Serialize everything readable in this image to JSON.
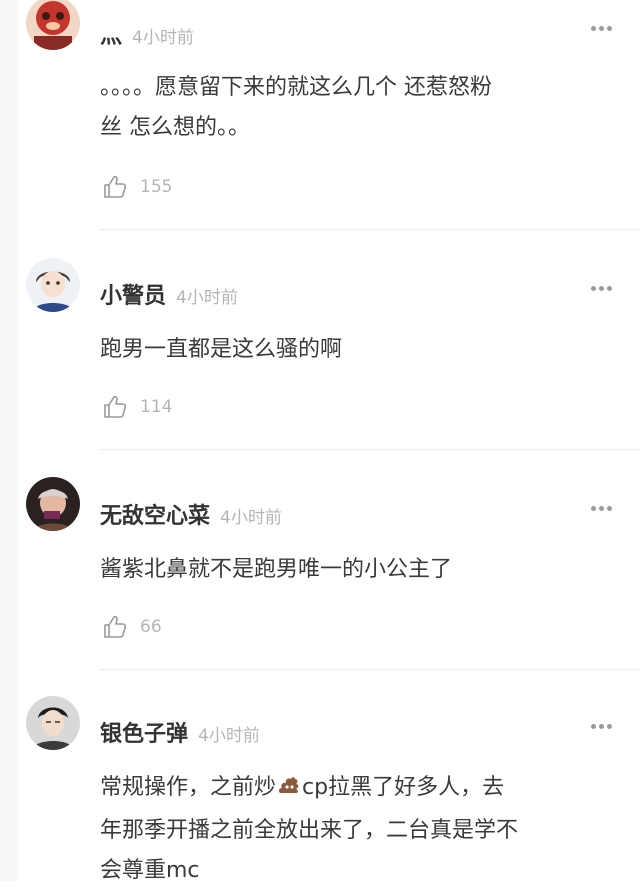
{
  "comments": [
    {
      "username": "灬",
      "time": "4小时前",
      "text_lines": [
        "。。。。愿意留下来的就这么几个 还惹怒粉",
        "丝 怎么想的。。"
      ],
      "likes": "155",
      "avatar_color": "#c4352d"
    },
    {
      "username": "小警员",
      "time": "4小时前",
      "text_lines": [
        "跑男一直都是这么骚的啊"
      ],
      "likes": "114",
      "avatar_color": "#2f4a8a"
    },
    {
      "username": "无敌空心菜",
      "time": "4小时前",
      "text_lines": [
        "酱紫北鼻就不是跑男唯一的小公主了"
      ],
      "likes": "66",
      "avatar_color": "#6b4a3a"
    },
    {
      "username": "银色子弹",
      "time": "4小时前",
      "text_lines": [
        "常规操作，之前炒",
        "cp拉黑了好多人，去",
        "年那季开播之前全放出来了，二台真是学不",
        "会尊重mc"
      ],
      "likes": "",
      "avatar_color": "#3b3b3b"
    }
  ],
  "icons": {
    "like": "thumbs-up-icon",
    "more": "more-dots-icon",
    "emoji": "poop-emoji-icon"
  }
}
